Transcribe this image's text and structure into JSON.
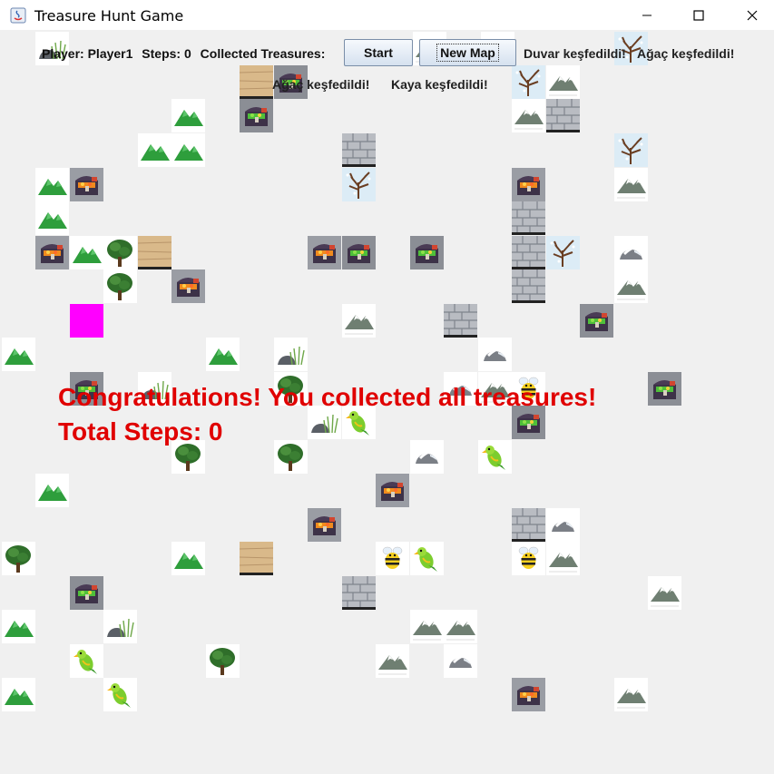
{
  "window": {
    "title": "Treasure Hunt Game"
  },
  "toolbar": {
    "player": "Player: Player1",
    "steps": "Steps: 0",
    "collected": "Collected Treasures:",
    "start_label": "Start",
    "new_map_label": "New Map"
  },
  "messages": {
    "line1": [
      "Duvar keşfedildi!",
      "Ağaç keşfedildi!"
    ],
    "line2": [
      "Ağaç keşfedildi!",
      "Kaya keşfedildi!"
    ]
  },
  "overlay": {
    "congratulations": "Congratulations! You collected all treasures!",
    "total_steps": "Total Steps: 0"
  },
  "colors": {
    "player": "#ff00ff",
    "congrats_text": "#e00000"
  },
  "tile_types": [
    "grass-mountain",
    "snow-mountain",
    "green-tree",
    "snow-tree",
    "brick-wall",
    "sand-block",
    "treasure-chest",
    "gold-chest",
    "rock",
    "parrot",
    "bee",
    "player"
  ]
}
